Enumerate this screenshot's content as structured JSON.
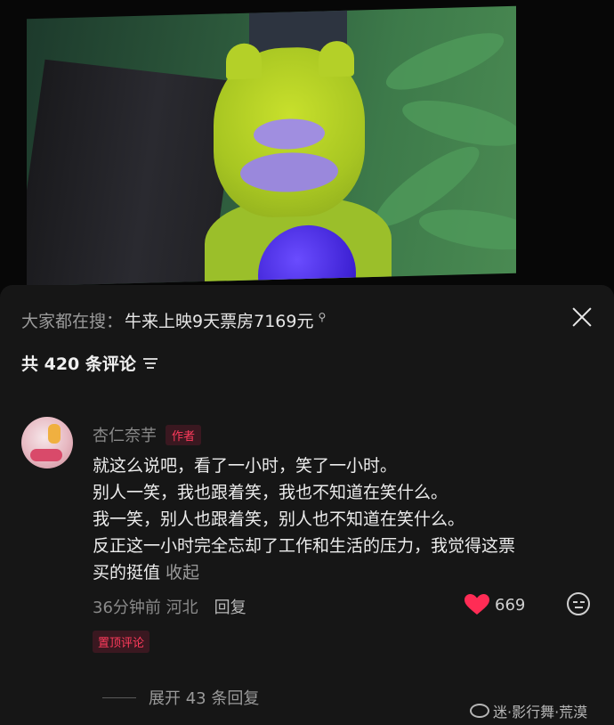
{
  "search_bar": {
    "prefix": "大家都在搜：",
    "query": "牛来上映9天票房7169元",
    "icon": "search-icon"
  },
  "header": {
    "comment_count_label": "共 420 条评论",
    "sort_icon": "filter-sort-icon",
    "close_icon": "close-icon"
  },
  "comment": {
    "avatar_icon": "avatar",
    "author": "杏仁奈芋",
    "author_badge": "作者",
    "lines": [
      "就这么说吧，看了一小时，笑了一小时。",
      "别人一笑，我也跟着笑，我也不知道在笑什么。",
      "我一笑，别人也跟着笑，别人也不知道在笑什么。",
      "反正这一小时完全忘却了工作和生活的压力，我觉得这票",
      "买的挺值"
    ],
    "collapse_label": "收起",
    "time_location": "36分钟前 河北",
    "reply_label": "回复",
    "like_count": "669",
    "like_color": "#ff2c55",
    "pin_badge": "置顶评论",
    "expand_replies_label": "展开 43 条回复"
  },
  "watermark": {
    "text": "迷·影行舞·荒漠"
  }
}
